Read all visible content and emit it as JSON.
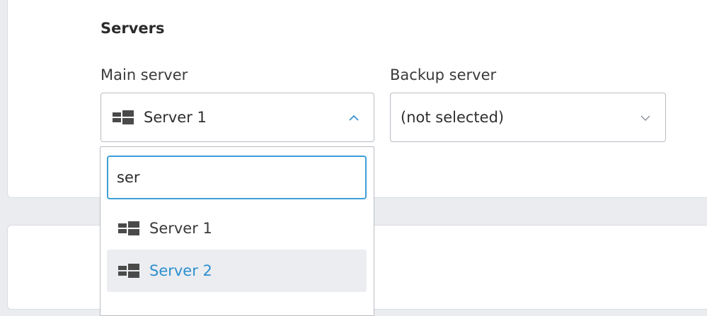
{
  "section": {
    "title": "Servers"
  },
  "main_server": {
    "label": "Main server",
    "selected": "Server 1",
    "icon": "windows-icon",
    "state": "open"
  },
  "backup_server": {
    "label": "Backup server",
    "selected": "(not selected)"
  },
  "dropdown": {
    "search_value": "ser",
    "options": [
      {
        "label": "Server 1",
        "icon": "windows-icon"
      },
      {
        "label": "Server 2",
        "icon": "windows-icon",
        "highlighted": true
      }
    ]
  },
  "colors": {
    "accent": "#3e9fd8",
    "highlight_text": "#2d8fce",
    "highlight_bg": "#ebedf0"
  }
}
